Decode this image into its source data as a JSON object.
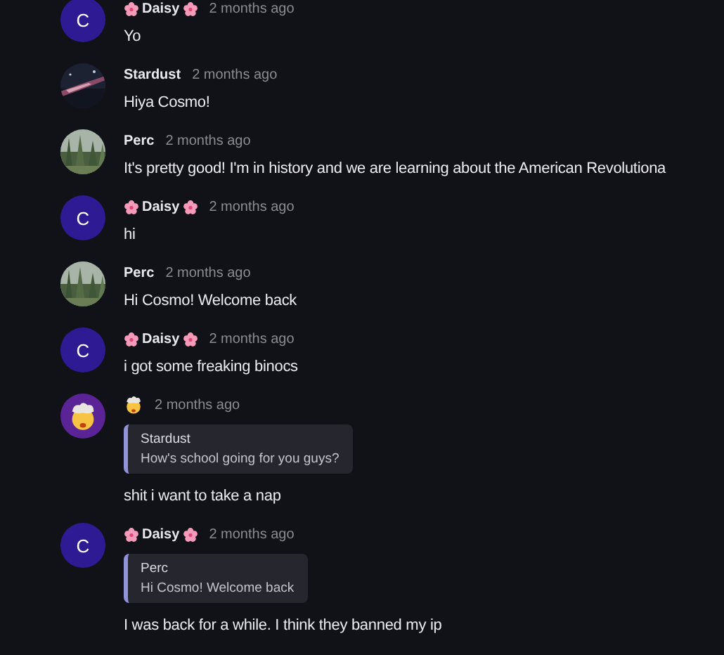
{
  "messages": [
    {
      "avatar": {
        "kind": "letter",
        "letter": "C"
      },
      "author": "Daisy",
      "flowers": true,
      "time": "2 months ago",
      "text": "Yo"
    },
    {
      "avatar": {
        "kind": "night"
      },
      "author": "Stardust",
      "flowers": false,
      "time": "2 months ago",
      "text": "Hiya Cosmo!"
    },
    {
      "avatar": {
        "kind": "forest"
      },
      "author": "Perc",
      "flowers": false,
      "time": "2 months ago",
      "text": "It's pretty good! I'm in history and we are learning about the American Revolutiona"
    },
    {
      "avatar": {
        "kind": "letter",
        "letter": "C"
      },
      "author": "Daisy",
      "flowers": true,
      "time": "2 months ago",
      "text": "hi"
    },
    {
      "avatar": {
        "kind": "forest"
      },
      "author": "Perc",
      "flowers": false,
      "time": "2 months ago",
      "text": "Hi Cosmo! Welcome back"
    },
    {
      "avatar": {
        "kind": "letter",
        "letter": "C"
      },
      "author": "Daisy",
      "flowers": true,
      "time": "2 months ago",
      "text": "i got some freaking binocs"
    },
    {
      "avatar": {
        "kind": "emoji"
      },
      "author_emoji": true,
      "time": "2 months ago",
      "reply": {
        "author": "Stardust",
        "text": "How's school going for you guys?"
      },
      "text": "shit i want to take a nap"
    },
    {
      "avatar": {
        "kind": "letter",
        "letter": "C"
      },
      "author": "Daisy",
      "flowers": true,
      "time": "2 months ago",
      "reply": {
        "author": "Perc",
        "text": "Hi Cosmo! Welcome back"
      },
      "text": "I was back for a while. I think they banned my ip"
    }
  ]
}
